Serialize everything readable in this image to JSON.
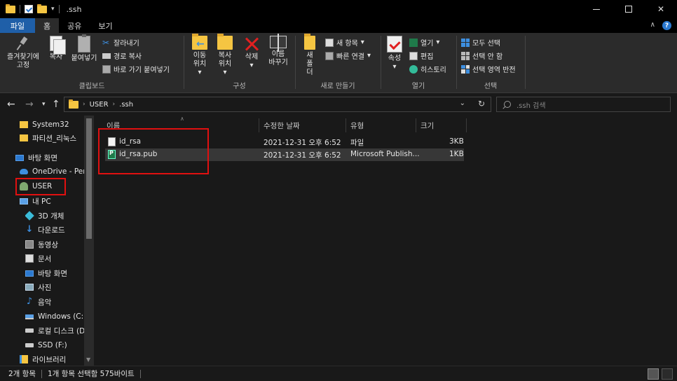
{
  "window": {
    "title": ".ssh"
  },
  "ribbon_tabs": [
    "파일",
    "홈",
    "공유",
    "보기"
  ],
  "ribbon": {
    "clipboard": {
      "label": "클립보드",
      "pin": "즐겨찾기에 고정",
      "copy": "복사",
      "paste": "붙여넣기",
      "cut": "잘라내기",
      "copy_path": "경로 복사",
      "paste_shortcut": "바로 가기 붙여넣기"
    },
    "organize": {
      "label": "구성",
      "move_to": "이동 위치",
      "copy_to": "복사 위치",
      "delete": "삭제",
      "rename": "이름 바꾸기"
    },
    "new": {
      "label": "새로 만들기",
      "new_folder": "새 폴더",
      "new_item": "새 항목",
      "easy_access": "빠른 연결"
    },
    "open": {
      "label": "열기",
      "properties": "속성",
      "open": "열기",
      "edit": "편집",
      "history": "히스토리"
    },
    "select": {
      "label": "선택",
      "select_all": "모두 선택",
      "select_none": "선택 안 함",
      "invert": "선택 영역 반전"
    }
  },
  "address": {
    "crumbs": [
      "USER",
      ".ssh"
    ],
    "search_placeholder": ".ssh 검색"
  },
  "nav": [
    {
      "label": "System32",
      "icon": "folder-icon"
    },
    {
      "label": "파티션_리눅스",
      "icon": "folder-icon"
    },
    {
      "label": "바탕 화면",
      "icon": "desktop-icon"
    },
    {
      "label": "OneDrive - Pers",
      "icon": "cloud-icon"
    },
    {
      "label": "USER",
      "icon": "user-icon"
    },
    {
      "label": "내 PC",
      "icon": "pc-icon"
    },
    {
      "label": "3D 개체",
      "icon": "cube-icon"
    },
    {
      "label": "다운로드",
      "icon": "download-icon"
    },
    {
      "label": "동영상",
      "icon": "video-icon"
    },
    {
      "label": "문서",
      "icon": "document-icon"
    },
    {
      "label": "바탕 화면",
      "icon": "desktop-icon"
    },
    {
      "label": "사진",
      "icon": "picture-icon"
    },
    {
      "label": "음악",
      "icon": "music-icon"
    },
    {
      "label": "Windows (C:)",
      "icon": "drive-c-icon"
    },
    {
      "label": "로컬 디스크 (D",
      "icon": "drive-icon"
    },
    {
      "label": "SSD (F:)",
      "icon": "drive-icon"
    },
    {
      "label": "라이브러리",
      "icon": "library-icon"
    }
  ],
  "columns": {
    "name": "이름",
    "modified": "수정한 날짜",
    "type": "유형",
    "size": "크기"
  },
  "files": [
    {
      "name": "id_rsa",
      "modified": "2021-12-31 오후 6:52",
      "type": "파일",
      "size": "3KB"
    },
    {
      "name": "id_rsa.pub",
      "modified": "2021-12-31 오후 6:52",
      "type": "Microsoft Publish...",
      "size": "1KB"
    }
  ],
  "status": {
    "count": "2개 항목",
    "selection": "1개 항목 선택함 575바이트"
  },
  "colors": {
    "accent": "#1f5fa8",
    "highlight": "#e01010",
    "background": "#191919"
  }
}
